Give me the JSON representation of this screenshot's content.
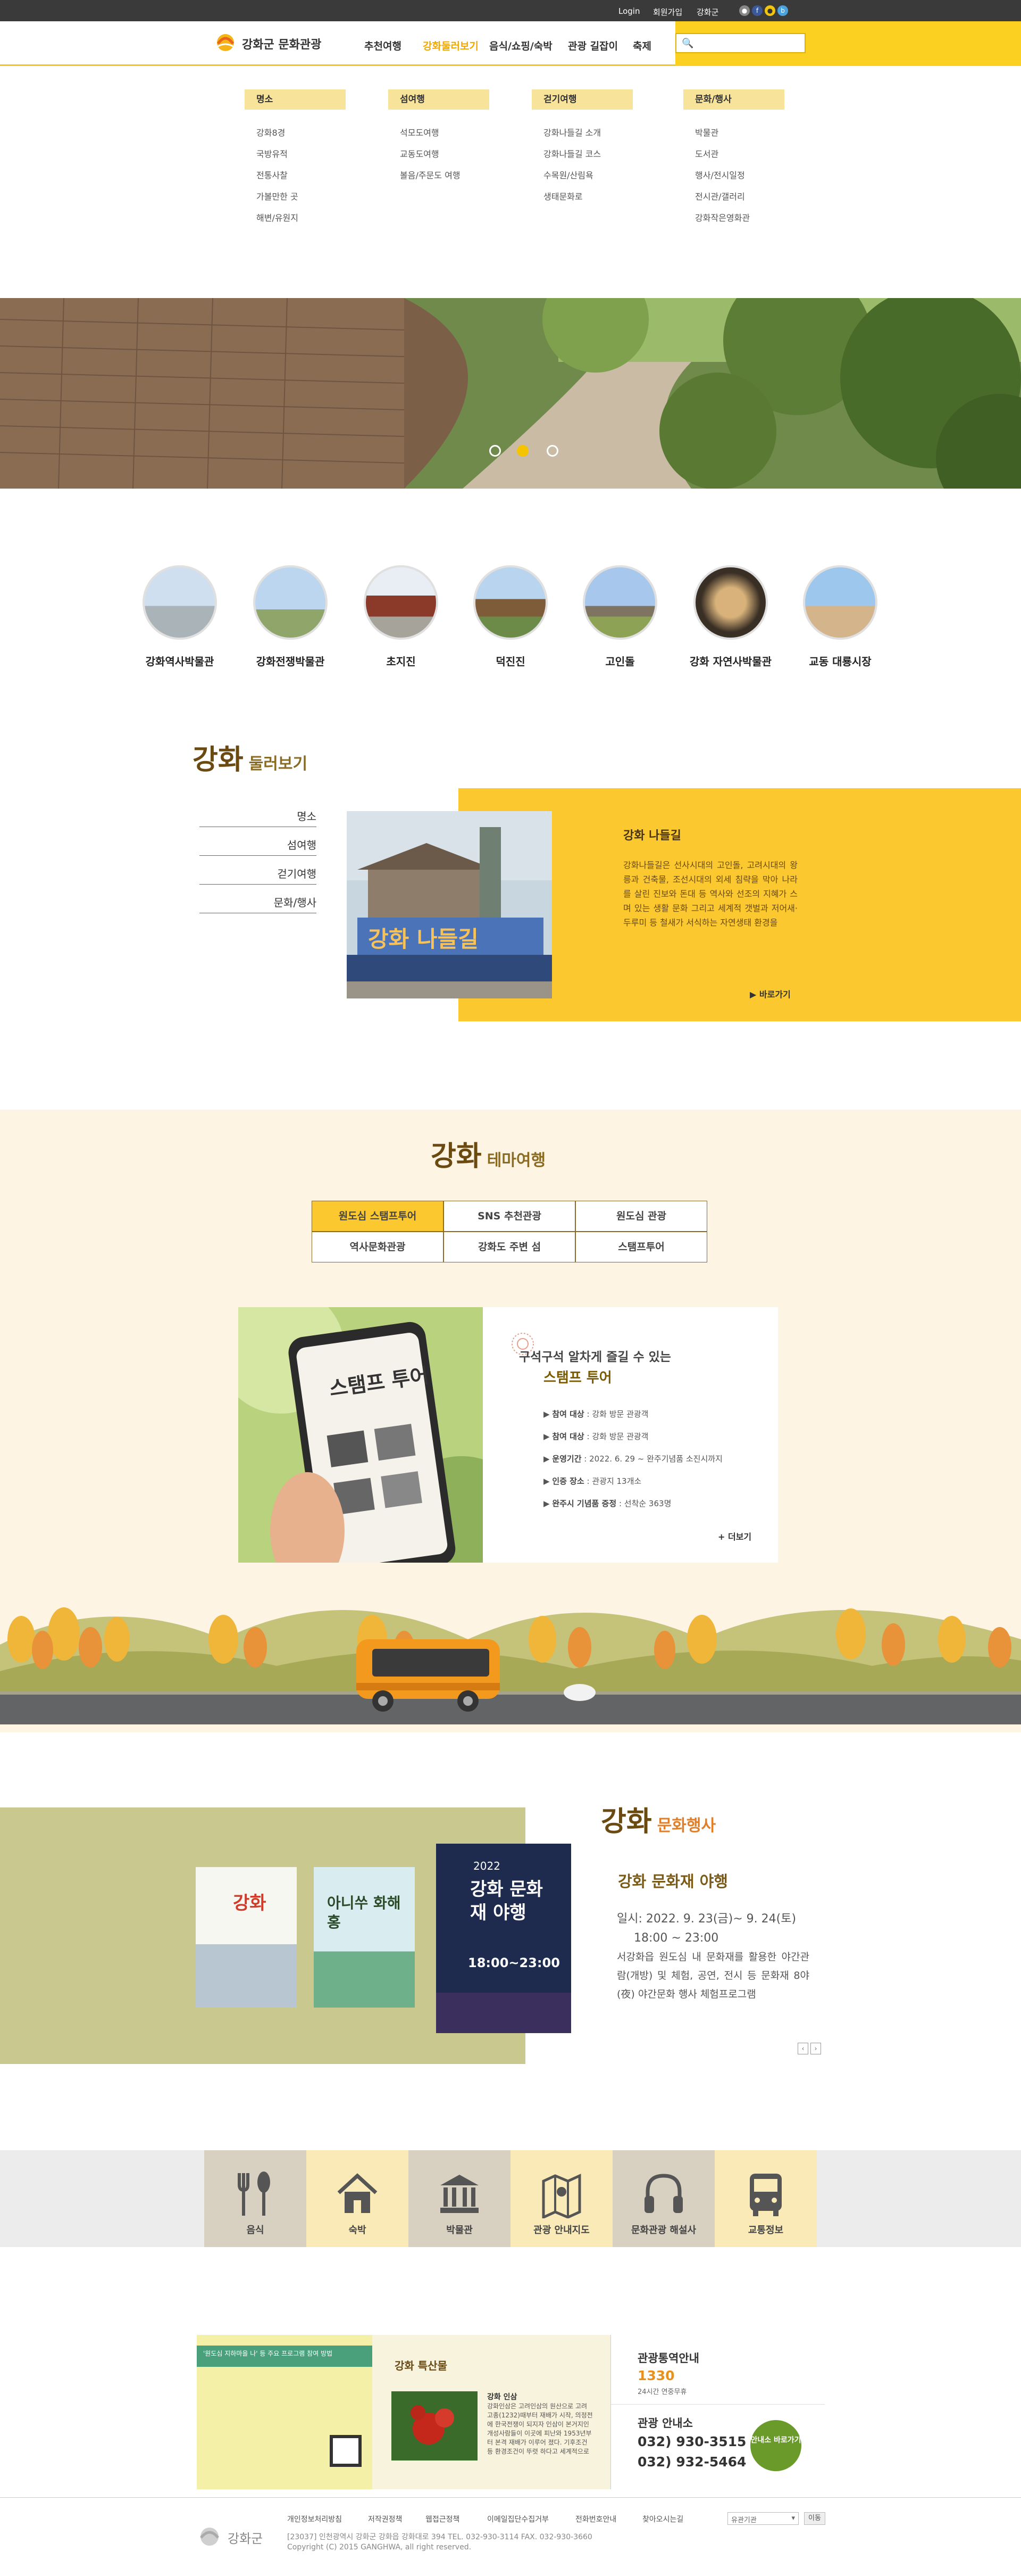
{
  "colors": {
    "accent": "#fbc92f",
    "topbar": "#3a3a3a",
    "brown": "#6b4a12",
    "olive": "#c9c88e",
    "cream": "#fdf4e4"
  },
  "topbar": {
    "login": "Login",
    "join": "회원가입",
    "ganghwa_gun": "강화군"
  },
  "header": {
    "logo": "강화군 문화관광",
    "gnb": [
      "추천여행",
      "강화둘러보기",
      "음식/쇼핑/숙박",
      "관광 길잡이",
      "축제"
    ]
  },
  "mega_menu": [
    {
      "title": "명소",
      "items": [
        "강화8경",
        "국방유적",
        "전통사찰",
        "가볼만한 곳",
        "해변/유원지"
      ]
    },
    {
      "title": "섬여행",
      "items": [
        "석모도여행",
        "교동도여행",
        "볼음/주문도 여행"
      ]
    },
    {
      "title": "걷기여행",
      "items": [
        "강화나들길 소개",
        "강화나들길 코스",
        "수목원/산림욕",
        "생태문화로"
      ]
    },
    {
      "title": "문화/행사",
      "items": [
        "박물관",
        "도서관",
        "행사/전시일정",
        "전시관/갤러리",
        "강화작은영화관"
      ]
    }
  ],
  "quick_places": [
    "강화역사박물관",
    "강화전쟁박물관",
    "초지진",
    "덕진진",
    "고인돌",
    "강화 자연사박물관",
    "교동 대룡시장"
  ],
  "explore": {
    "title_main": "강화",
    "title_sub": "둘러보기",
    "menu": [
      "명소",
      "섬여행",
      "걷기여행",
      "문화/행사"
    ],
    "card_title": "강화 나들길",
    "card_body": "강화나들길은 선사시대의 고인돌, 고려시대의 왕릉과 건축물, 조선시대의 외세 침략을 막아 나라를 살린 진보와 돈대 등 역사와 선조의 지혜가 스며 있는 생활 문화 그리고 세계적 갯벌과 저어새·두루미 등 철새가 서식하는 자연생태 환경을",
    "more": "바로가기"
  },
  "theme": {
    "title_main": "강화",
    "title_sub": "테마여행",
    "tabs": [
      [
        "원도심 스탬프투어",
        "SNS 추천관광",
        "원도심 관광"
      ],
      [
        "역사문화관광",
        "강화도 주변 섬",
        "스탬프투어"
      ]
    ],
    "card_sub": "구석구석 알차게 즐길 수 있는",
    "card_title": "스탬프 투어",
    "phone_text": "스탬프 투어",
    "info": [
      {
        "k": "참여 대상",
        "v": "강화 방문 관광객"
      },
      {
        "k": "참여 대상",
        "v": "강화 방문 관광객"
      },
      {
        "k": "운영기간",
        "v": "2022. 6. 29 ~ 완주기념품 소진시까지"
      },
      {
        "k": "인증 장소",
        "v": "관광지 13개소"
      },
      {
        "k": "완주시 기념품 증정",
        "v": "선착순 363명"
      }
    ],
    "more": "+ 더보기"
  },
  "festival": {
    "title_main": "강화",
    "title_sub": "문화행사",
    "event_title": "강화 문화재 야행",
    "date_line1": "일시: 2022. 9. 23(금)~ 9. 24(토)",
    "date_line2": "18:00 ~ 23:00",
    "desc": "서강화읍 원도심 내 문화재를 활용한 야간관람(개방) 및 체험, 공연, 전시 등 문화재 8야(夜) 야간문화 행사 체험프로그램",
    "poster1_text": "강화",
    "poster2_text": "아니쑤 화해 홍",
    "poster3_text": "강화 문화재 야행",
    "poster3_year": "2022",
    "poster3_time": "18:00~23:00"
  },
  "quick_menu": [
    "음식",
    "숙박",
    "박물관",
    "관광 안내지도",
    "문화관광 해설사",
    "교통정보"
  ],
  "bottom": {
    "banner_title": "강화 특산물",
    "product": "강화 인삼",
    "product_desc": "강화인삼은 고려인삼의 원산으로 고려 고종(1232)때부터 재배가 시작, 의정전에 한국전쟁이 되지자 인삼이 본거지인 개성사람들이 이곳에 피난와 1953년부터 본격 재배가 이루어 졌다. 기후조건 등 환경조건이 뚜렷 하다고 세계적으로",
    "promo_line": "'원도심 지하마을 나' 등 주요 프로그램 참여 방법",
    "tour_info_title": "관광통역안내",
    "tour_info_num": "1330",
    "tour_info_sub": "24시간 연중무휴",
    "center_title": "관광 안내소",
    "phone1": "032) 930-3515",
    "phone2": "032) 932-5464",
    "center_btn": "안내소 바로가기"
  },
  "footer": {
    "links": [
      "개인정보처리방침",
      "저작권정책",
      "웹접근정책",
      "이메일집단수집거부",
      "전화번호안내",
      "찾아오시는길"
    ],
    "address": "[23037] 인천광역시 강화군 강화읍 강화대로 394 TEL. 032-930-3114 FAX. 032-930-3660",
    "copyright": "Copyright (C) 2015 GANGHWA, all right reserved.",
    "logo": "강화군",
    "select": "유관기관",
    "go": "이동"
  }
}
